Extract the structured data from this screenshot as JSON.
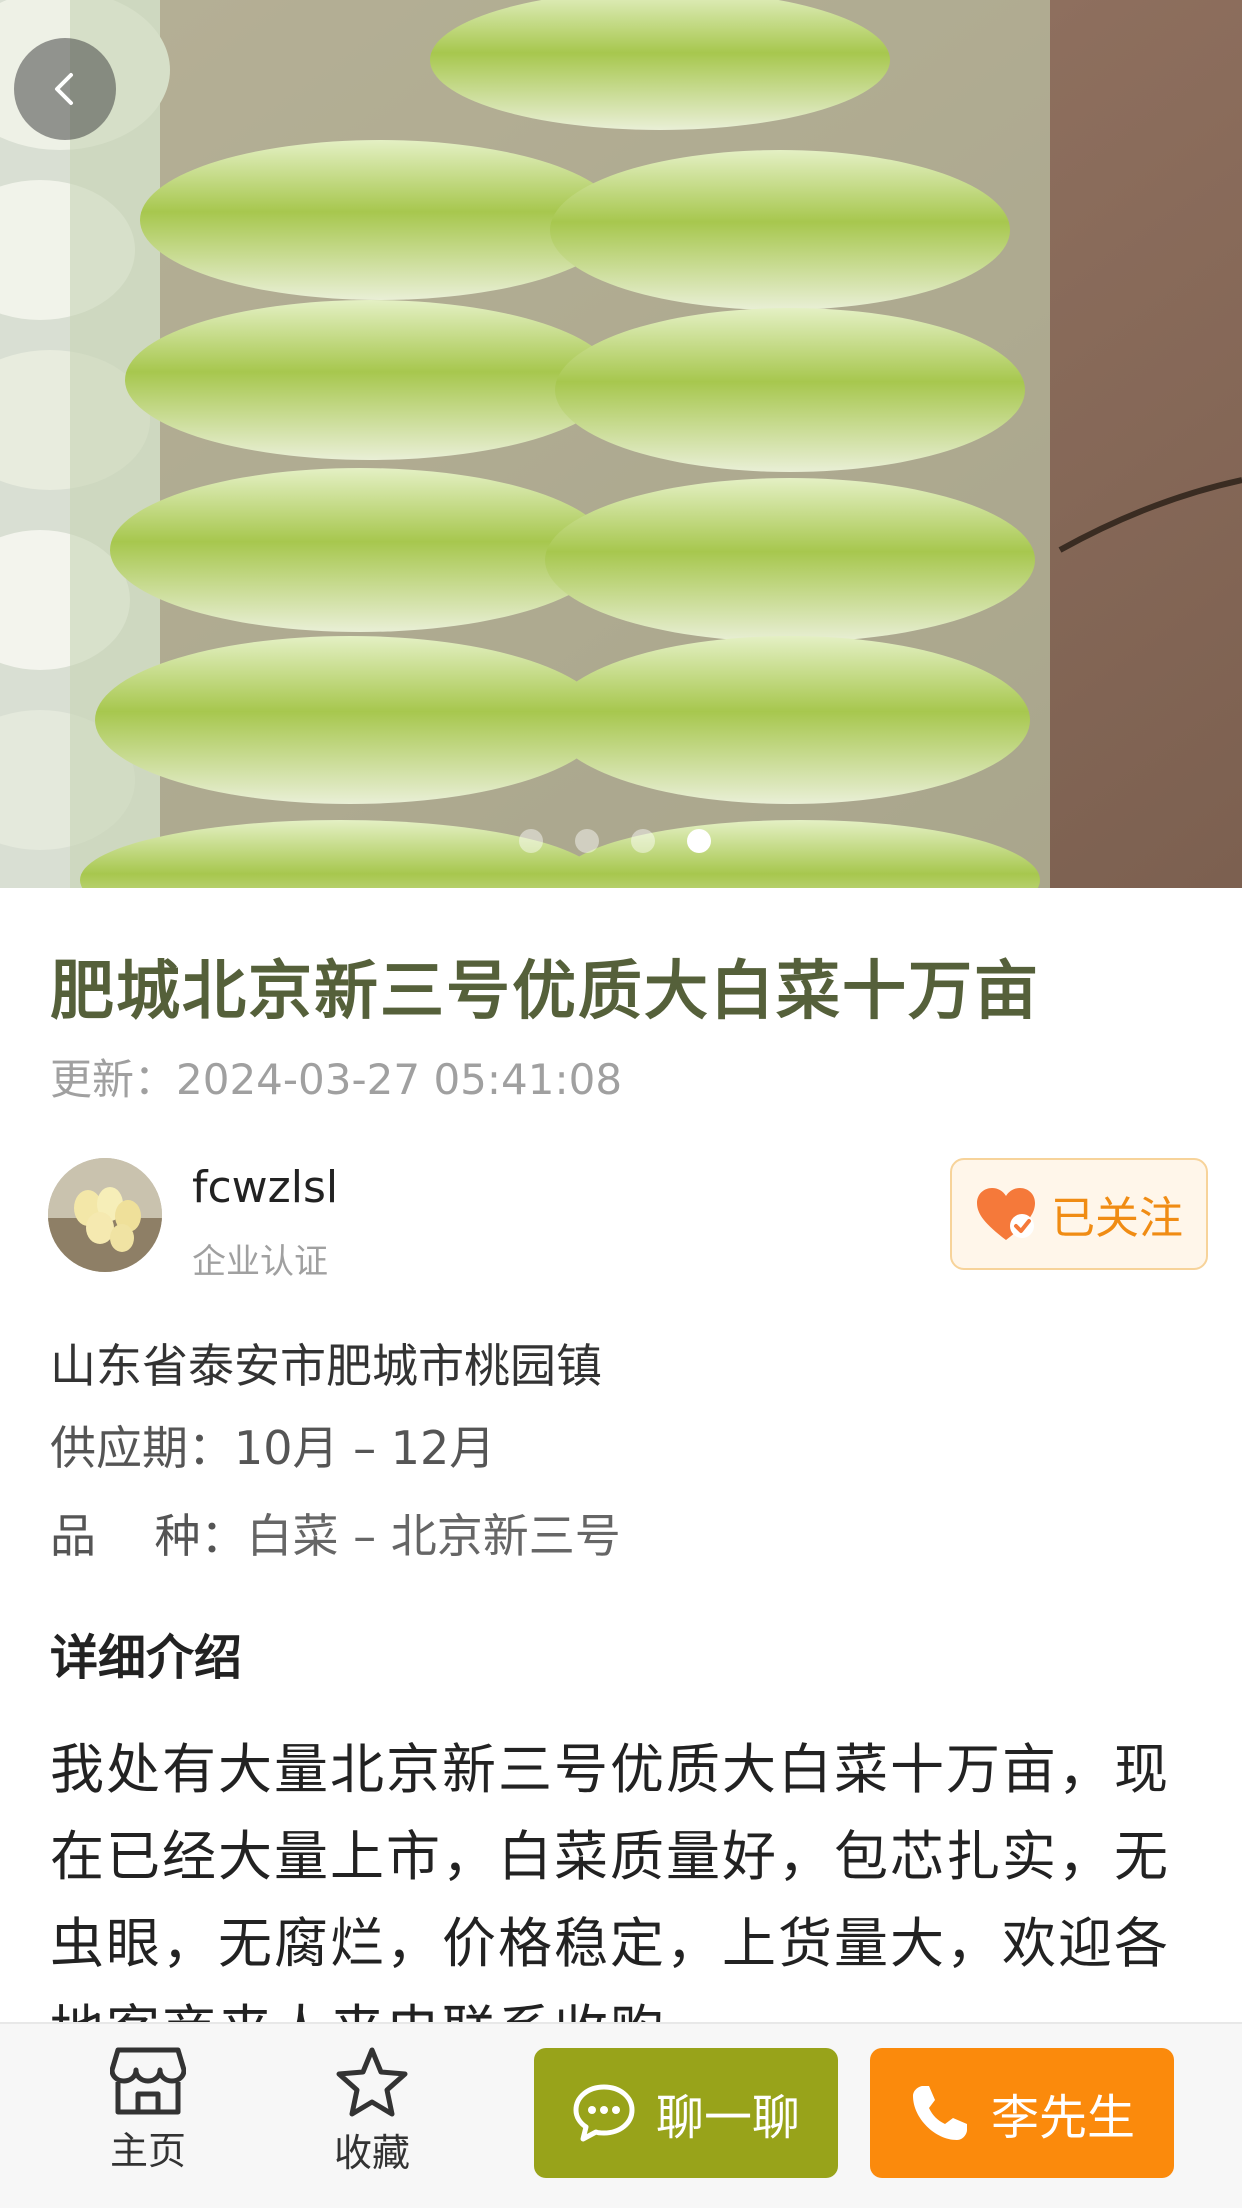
{
  "product": {
    "title": "肥城北京新三号优质大白菜十万亩",
    "updated_label": "更新：",
    "updated_value": "2024-03-27 05:41:08",
    "image_count": 4,
    "active_image_index": 3
  },
  "seller": {
    "name": "fcwzlsl",
    "badge": "企业认证",
    "follow_label": "已关注"
  },
  "info": {
    "location": "山东省泰安市肥城市桃园镇",
    "supply_label": "供应期：",
    "supply_value": "10月 – 12月",
    "variety_label": "品    种：",
    "variety_value": "白菜 – 北京新三号"
  },
  "details": {
    "heading": "详细介绍",
    "text": "我处有大量北京新三号优质大白菜十万亩，现在已经大量上市，白菜质量好，包芯扎实，无虫眼，无腐烂，价格稳定，上货量大，欢迎各地客商来人来电联系收购。"
  },
  "bottom_bar": {
    "home_label": "主页",
    "favorite_label": "收藏",
    "chat_label": "聊一聊",
    "call_label": "李先生"
  },
  "colors": {
    "title": "#55603a",
    "chat_button": "#98a31a",
    "call_button": "#fb8a0c",
    "follow_text": "#f08c14"
  },
  "icons": [
    "chevron-left-icon",
    "heart-check-icon",
    "store-icon",
    "star-icon",
    "chat-bubble-icon",
    "phone-icon"
  ]
}
